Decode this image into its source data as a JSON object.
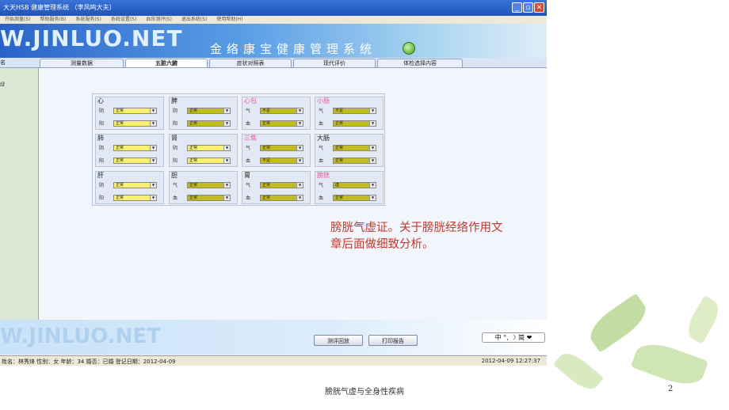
{
  "window": {
    "title": "大天HSB 健康管理系统 （李风鸣大夫）",
    "minimize_icon": "minimize-icon",
    "restore_icon": "restore-icon",
    "close_icon": "close-icon"
  },
  "menu": [
    "开始测量(S)",
    "帮助服务(B)",
    "系统服务(S)",
    "系统设置(S)",
    "血压测评(S)",
    "退出系统(S)",
    "使用帮助(H)"
  ],
  "banner": {
    "logo": "W.JINLUO.NET",
    "system_name": "金络康宝健康管理系统"
  },
  "tabs": [
    "测量数据",
    "五脏六腑",
    "症状对照表",
    "现代评价",
    "体检选择内容"
  ],
  "active_tab": "五脏六腑",
  "left_panel": {
    "header": "名",
    "item": "绿"
  },
  "organs": [
    {
      "name": "心",
      "label_color": "#222222",
      "rows": [
        {
          "label": "阴",
          "value": "正常",
          "style": "light"
        },
        {
          "label": "阳",
          "value": "正常",
          "style": "light"
        }
      ]
    },
    {
      "name": "脾",
      "label_color": "#222222",
      "rows": [
        {
          "label": "阴",
          "value": "正常",
          "style": "dark"
        },
        {
          "label": "阳",
          "value": "正常",
          "style": "dark"
        }
      ]
    },
    {
      "name": "心包",
      "label_color": "#e0609a",
      "rows": [
        {
          "label": "气",
          "value": "不足",
          "style": "dark"
        },
        {
          "label": "血",
          "value": "正常",
          "style": "dark"
        }
      ]
    },
    {
      "name": "小肠",
      "label_color": "#e0609a",
      "rows": [
        {
          "label": "气",
          "value": "不足",
          "style": "dark"
        },
        {
          "label": "血",
          "value": "正常",
          "style": "dark"
        }
      ]
    },
    {
      "name": "肺",
      "label_color": "#222222",
      "rows": [
        {
          "label": "阴",
          "value": "正常",
          "style": "light"
        },
        {
          "label": "阳",
          "value": "正常",
          "style": "light"
        }
      ]
    },
    {
      "name": "肾",
      "label_color": "#222222",
      "rows": [
        {
          "label": "阴",
          "value": "正常",
          "style": "light"
        },
        {
          "label": "阳",
          "value": "正常",
          "style": "light"
        }
      ]
    },
    {
      "name": "三焦",
      "label_color": "#e0609a",
      "rows": [
        {
          "label": "气",
          "value": "正常",
          "style": "dark"
        },
        {
          "label": "血",
          "value": "不足",
          "style": "dark"
        }
      ]
    },
    {
      "name": "大肠",
      "label_color": "#222222",
      "rows": [
        {
          "label": "气",
          "value": "正常",
          "style": "dark"
        },
        {
          "label": "血",
          "value": "正常",
          "style": "dark"
        }
      ]
    },
    {
      "name": "肝",
      "label_color": "#222222",
      "rows": [
        {
          "label": "阴",
          "value": "正常",
          "style": "light"
        },
        {
          "label": "阳",
          "value": "正常",
          "style": "light"
        }
      ]
    },
    {
      "name": "胆",
      "label_color": "#222222",
      "rows": [
        {
          "label": "气",
          "value": "正常",
          "style": "dark"
        },
        {
          "label": "血",
          "value": "正常",
          "style": "dark"
        }
      ]
    },
    {
      "name": "胃",
      "label_color": "#222222",
      "rows": [
        {
          "label": "气",
          "value": "正常",
          "style": "dark"
        },
        {
          "label": "血",
          "value": "正常",
          "style": "dark"
        }
      ]
    },
    {
      "name": "膀胱",
      "label_color": "#e0609a",
      "rows": [
        {
          "label": "气",
          "value": "虚",
          "style": "dark"
        },
        {
          "label": "血",
          "value": "正常",
          "style": "dark"
        }
      ]
    }
  ],
  "bottom": {
    "logo": "W.JINLUO.NET",
    "replay_button": "测评回放",
    "print_button": "打印报告",
    "ime_text": "中 °, ☽ 简 ❤"
  },
  "status": {
    "patient": "姓名：林秀烽   性别：女   年龄：34   婚否：已婚   登记日期：2012-04-09",
    "datetime": "2012-04-09 12:27:37"
  },
  "note": "膀胱气虚证。关于膀胱经络作用文章后面做细致分析。",
  "footer": "膀胱气虚与全身性疾病",
  "page_number": "2"
}
